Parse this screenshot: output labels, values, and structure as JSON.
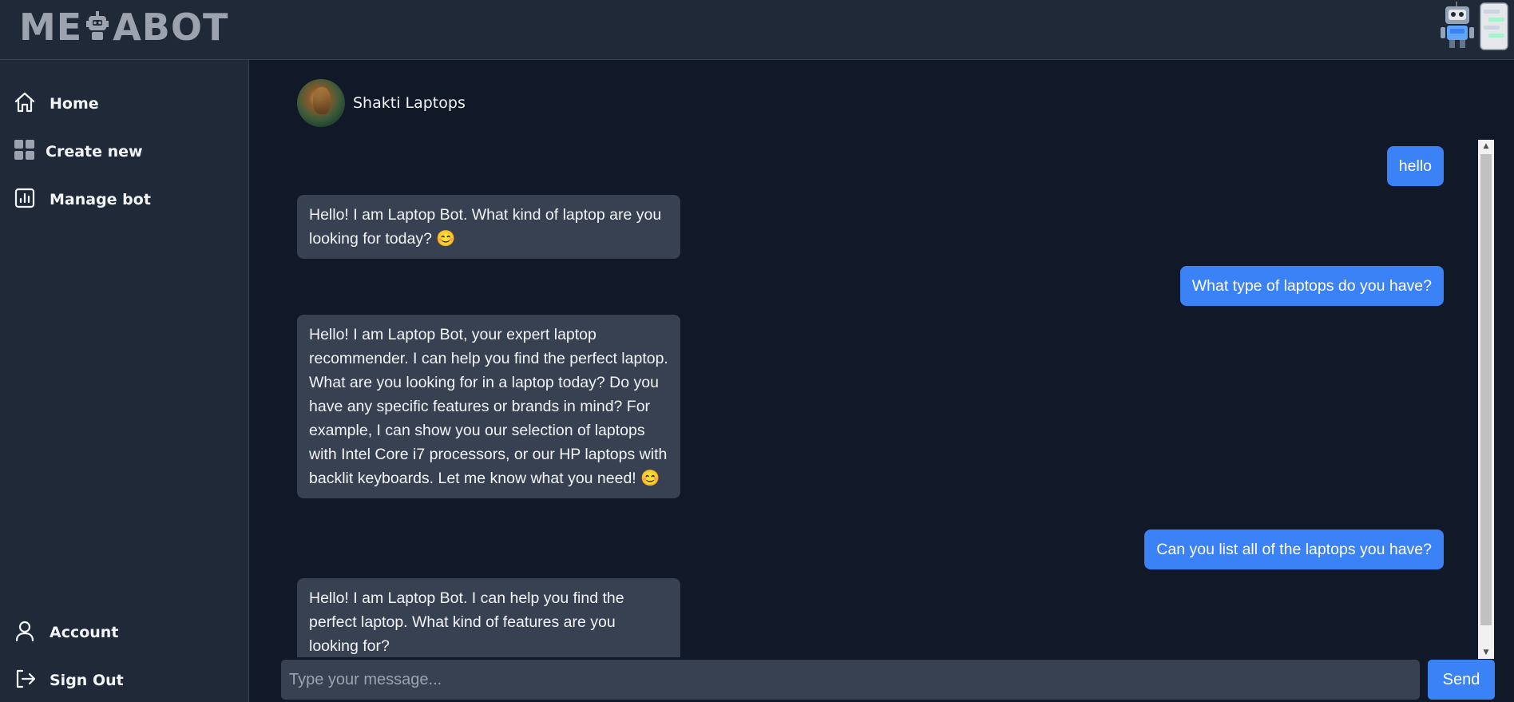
{
  "app": {
    "logo_part1": "ME",
    "logo_part2": "ABOT"
  },
  "sidebar": {
    "top_items": [
      {
        "label": "Home",
        "icon": "home-icon"
      },
      {
        "label": "Create new",
        "icon": "grid-icon"
      },
      {
        "label": "Manage bot",
        "icon": "chart-icon"
      }
    ],
    "bottom_items": [
      {
        "label": "Account",
        "icon": "user-icon"
      },
      {
        "label": "Sign Out",
        "icon": "sign-out-icon"
      }
    ]
  },
  "bot": {
    "name": "Shakti Laptops"
  },
  "messages": [
    {
      "role": "user",
      "text": "hello"
    },
    {
      "role": "bot",
      "text": "Hello! I am Laptop Bot. What kind of laptop are you looking for today? 😊"
    },
    {
      "role": "user",
      "text": "What type of laptops do you have?"
    },
    {
      "role": "bot",
      "text": "Hello! I am Laptop Bot, your expert laptop recommender. I can help you find the perfect laptop. What are you looking for in a laptop today? Do you have any specific features or brands in mind? For example, I can show you our selection of laptops with Intel Core i7 processors, or our HP laptops with backlit keyboards. Let me know what you need! 😊"
    },
    {
      "role": "user",
      "text": "Can you list all of the laptops you have?"
    },
    {
      "role": "bot",
      "text": "Hello! I am Laptop Bot. I can help you find the perfect laptop. What kind of features are you looking for?"
    }
  ],
  "composer": {
    "placeholder": "Type your message...",
    "send_label": "Send"
  },
  "colors": {
    "background": "#111827",
    "panel": "#1f2937",
    "bubble_bot": "#374151",
    "bubble_user": "#3b82f6"
  }
}
